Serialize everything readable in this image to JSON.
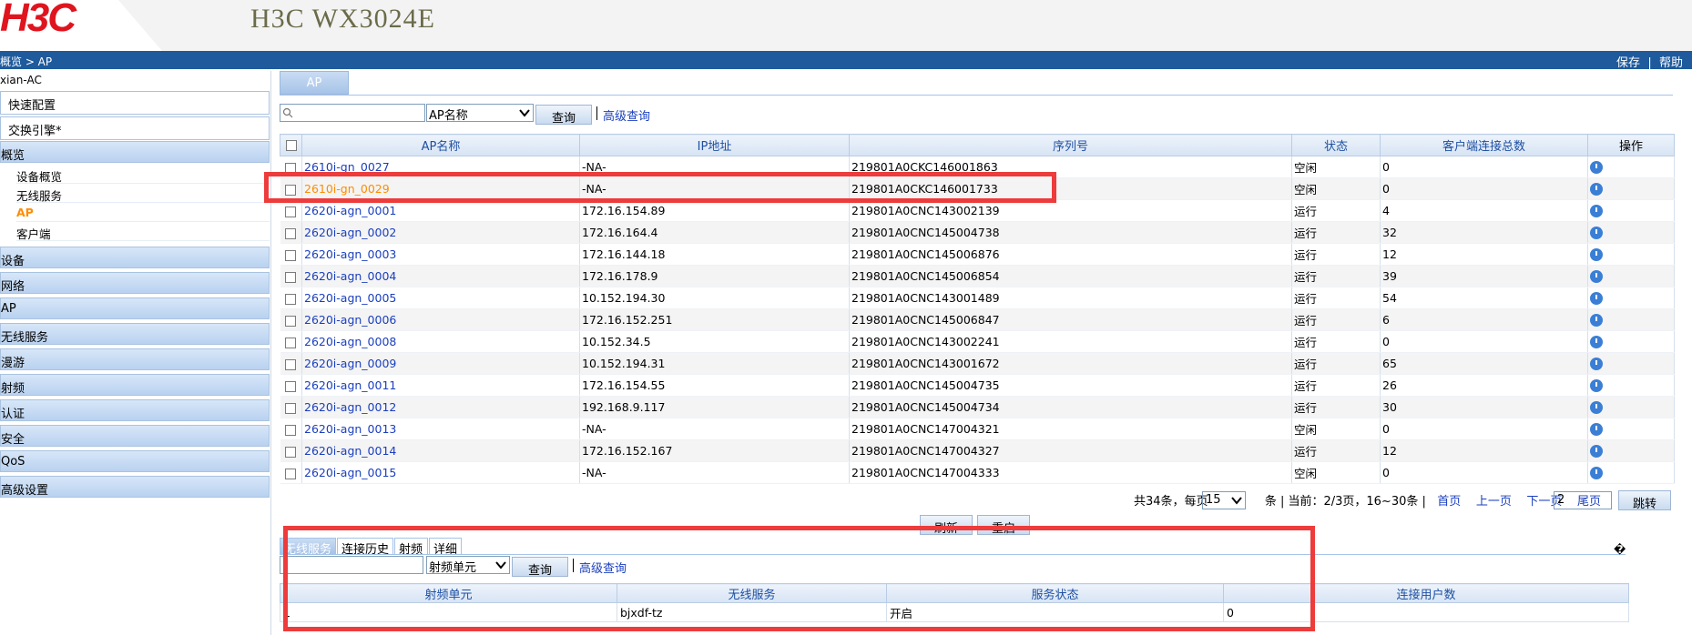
{
  "header": {
    "logo": "H3C",
    "device_title": "H3C  WX3024E",
    "breadcrumb": "概览 > AP",
    "right_links": [
      "保存",
      "帮助"
    ]
  },
  "sidebar": {
    "root": "xian-AC",
    "quick": [
      "快速配置",
      "交换引擎*"
    ],
    "overview": "概览",
    "overview_items": [
      "设备概览",
      "无线服务",
      "AP",
      "客户端"
    ],
    "sections": [
      "设备",
      "网络",
      "AP",
      "无线服务",
      "漫游",
      "射频",
      "认证",
      "安全",
      "QoS",
      "高级设置"
    ]
  },
  "main": {
    "tab": "AP",
    "search": {
      "placeholder": "",
      "field": "AP名称",
      "query_label": "查询",
      "advanced_label": "高级查询"
    },
    "columns": [
      "AP名称",
      "IP地址",
      "序列号",
      "状态",
      "客户端连接总数",
      "操作"
    ],
    "rows": [
      [
        "2610i-gn_0027",
        "-NA-",
        "219801A0CKC146001863",
        "空闲",
        "0"
      ],
      [
        "2610i-gn_0029",
        "-NA-",
        "219801A0CKC146001733",
        "空闲",
        "0"
      ],
      [
        "2620i-agn_0001",
        "172.16.154.89",
        "219801A0CNC143002139",
        "运行",
        "4"
      ],
      [
        "2620i-agn_0002",
        "172.16.164.4",
        "219801A0CNC145004738",
        "运行",
        "32"
      ],
      [
        "2620i-agn_0003",
        "172.16.144.18",
        "219801A0CNC145006876",
        "运行",
        "12"
      ],
      [
        "2620i-agn_0004",
        "172.16.178.9",
        "219801A0CNC145006854",
        "运行",
        "39"
      ],
      [
        "2620i-agn_0005",
        "10.152.194.30",
        "219801A0CNC143001489",
        "运行",
        "54"
      ],
      [
        "2620i-agn_0006",
        "172.16.152.251",
        "219801A0CNC145006847",
        "运行",
        "6"
      ],
      [
        "2620i-agn_0008",
        "10.152.34.5",
        "219801A0CNC143002241",
        "运行",
        "0"
      ],
      [
        "2620i-agn_0009",
        "10.152.194.31",
        "219801A0CNC143001672",
        "运行",
        "65"
      ],
      [
        "2620i-agn_0011",
        "172.16.154.55",
        "219801A0CNC145004735",
        "运行",
        "26"
      ],
      [
        "2620i-agn_0012",
        "192.168.9.117",
        "219801A0CNC145004734",
        "运行",
        "30"
      ],
      [
        "2620i-agn_0013",
        "-NA-",
        "219801A0CNC147004321",
        "空闲",
        "0"
      ],
      [
        "2620i-agn_0014",
        "172.16.152.167",
        "219801A0CNC147004327",
        "运行",
        "12"
      ],
      [
        "2620i-agn_0015",
        "-NA-",
        "219801A0CNC147004333",
        "空闲",
        "0"
      ]
    ],
    "pagination": {
      "summary_a": "共34条，每页",
      "per_page": "15",
      "summary_b": "条 | 当前：2/3页，16~30条 |",
      "links": [
        "首页",
        "上一页",
        "下一页",
        "尾页"
      ],
      "page_input": "2",
      "jump_label": "跳转"
    },
    "actions": [
      "刷新",
      "重启"
    ]
  },
  "detail": {
    "tabs": [
      "无线服务",
      "连接历史",
      "射频",
      "详细"
    ],
    "search": {
      "field": "射频单元",
      "query_label": "查询",
      "advanced_label": "高级查询"
    },
    "columns": [
      "射频单元",
      "无线服务",
      "服务状态",
      "连接用户数"
    ],
    "rows": [
      [
        "1",
        "bjxdf-tz",
        "开启",
        "0"
      ]
    ],
    "help_glyph": "�"
  },
  "colors": {
    "brand_red": "#e0141e",
    "bar_blue": "#1e5a9c",
    "link_blue": "#1a3fbf",
    "selected_orange": "#ff8c00",
    "highlight_red": "#ee3b3b"
  }
}
